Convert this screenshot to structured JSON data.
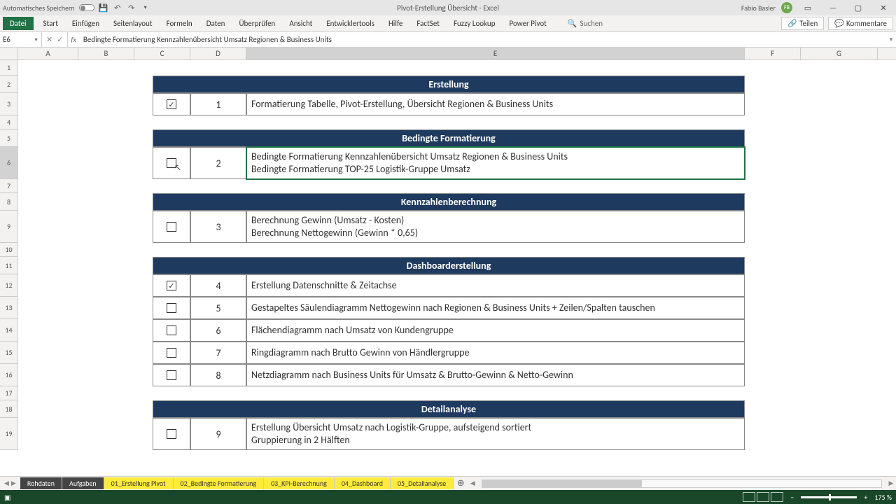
{
  "title": {
    "autosave": "Automatisches Speichern",
    "doc": "Pivot-Erstellung Übersicht - Excel",
    "user": "Fabio Basler",
    "initials": "FB"
  },
  "ribbon": {
    "file": "Datei",
    "tabs": [
      "Start",
      "Einfügen",
      "Seitenlayout",
      "Formeln",
      "Daten",
      "Überprüfen",
      "Ansicht",
      "Entwicklertools",
      "Hilfe",
      "FactSet",
      "Fuzzy Lookup",
      "Power Pivot"
    ],
    "search": "Suchen",
    "share": "Teilen",
    "comments": "Kommentare"
  },
  "namebox": "E6",
  "formula": "Bedingte Formatierung Kennzahlenübersicht Umsatz Regionen & Business Units",
  "cols": [
    "A",
    "B",
    "C",
    "D",
    "E",
    "F",
    "G"
  ],
  "rows": [
    "1",
    "2",
    "3",
    "4",
    "5",
    "6",
    "7",
    "8",
    "9",
    "10",
    "11",
    "12",
    "13",
    "14",
    "15",
    "16",
    "17",
    "18",
    "19"
  ],
  "sections": {
    "s1": {
      "title": "Erstellung",
      "items": [
        {
          "chk": true,
          "num": "1",
          "lines": [
            "Formatierung Tabelle, Pivot-Erstellung, Übersicht Regionen & Business Units"
          ]
        }
      ]
    },
    "s2": {
      "title": "Bedingte Formatierung",
      "items": [
        {
          "chk": false,
          "num": "2",
          "lines": [
            "Bedingte Formatierung Kennzahlenübersicht Umsatz Regionen & Business Units",
            "Bedingte Formatierung TOP-25 Logistik-Gruppe Umsatz"
          ]
        }
      ]
    },
    "s3": {
      "title": "Kennzahlenberechnung",
      "items": [
        {
          "chk": false,
          "num": "3",
          "lines": [
            "Berechnung Gewinn (Umsatz - Kosten)",
            "Berechnung Nettogewinn (Gewinn * 0,65)"
          ]
        }
      ]
    },
    "s4": {
      "title": "Dashboarderstellung",
      "items": [
        {
          "chk": true,
          "num": "4",
          "lines": [
            "Erstellung Datenschnitte & Zeitachse"
          ]
        },
        {
          "chk": false,
          "num": "5",
          "lines": [
            "Gestapeltes Säulendiagramm Nettogewinn nach Regionen & Business Units + Zeilen/Spalten tauschen"
          ]
        },
        {
          "chk": false,
          "num": "6",
          "lines": [
            "Flächendiagramm nach Umsatz von Kundengruppe"
          ]
        },
        {
          "chk": false,
          "num": "7",
          "lines": [
            "Ringdiagramm nach Brutto Gewinn von Händlergruppe"
          ]
        },
        {
          "chk": false,
          "num": "8",
          "lines": [
            "Netzdiagramm nach Business Units für Umsatz & Brutto-Gewinn & Netto-Gewinn"
          ]
        }
      ]
    },
    "s5": {
      "title": "Detailanalyse",
      "items": [
        {
          "chk": false,
          "num": "9",
          "lines": [
            "Erstellung Übersicht Umsatz nach Logistik-Gruppe, aufsteigend sortiert",
            "Gruppierung in 2 Hälften"
          ]
        }
      ]
    }
  },
  "sheets": {
    "dark": [
      "Rohdaten",
      "Aufgaben"
    ],
    "yellow": [
      "01_Erstellung Pivot",
      "02_Bedingte Formatierung",
      "03_KPI-Berechnung",
      "04_Dashboard",
      "05_Detailanalyse"
    ]
  },
  "zoom": "175 %"
}
